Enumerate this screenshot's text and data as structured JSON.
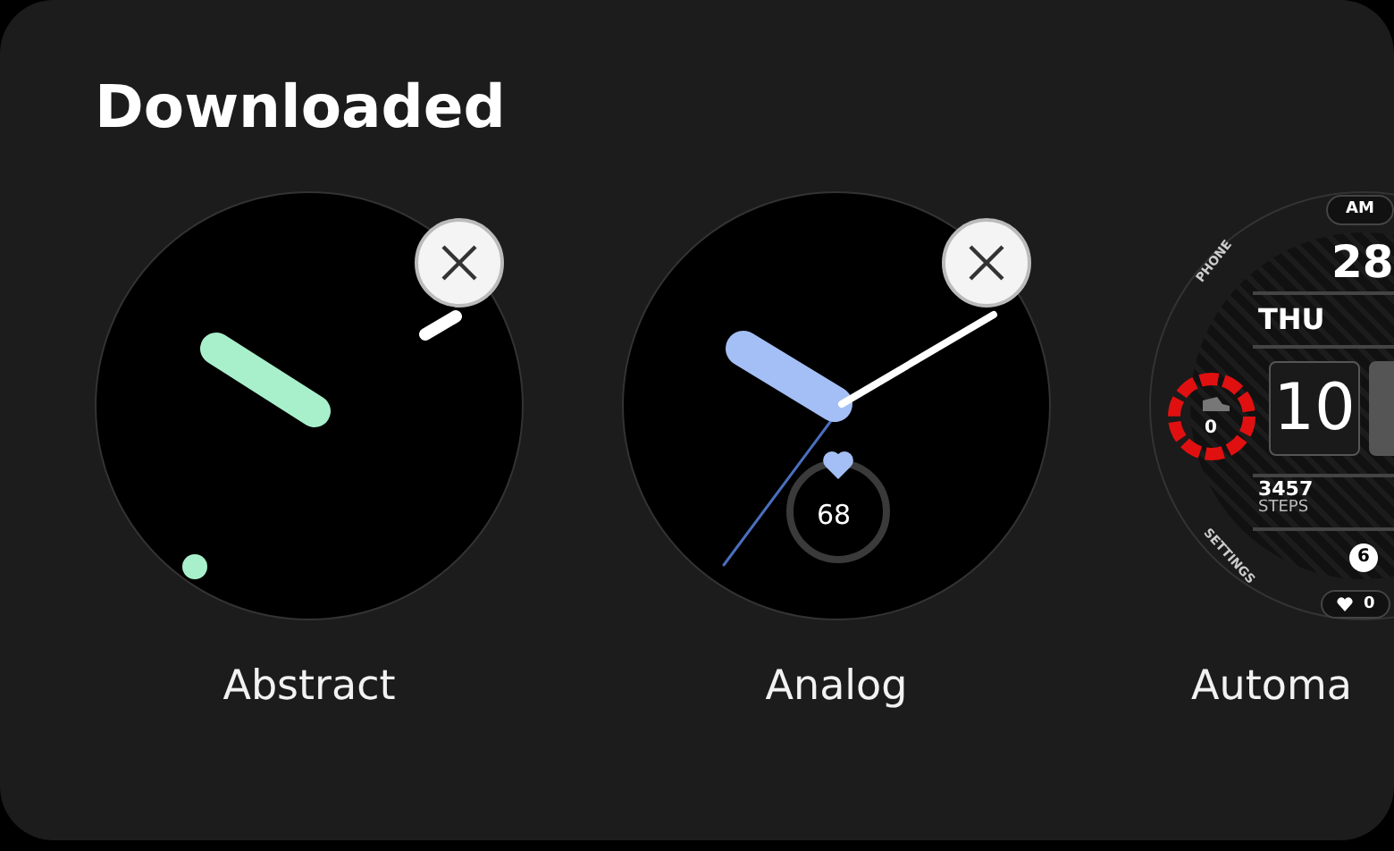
{
  "title": "Downloaded",
  "faces": [
    {
      "name": "Abstract",
      "kind": "abstract",
      "removable": true
    },
    {
      "name": "Analog",
      "kind": "analog",
      "removable": true,
      "heart_rate": "68"
    },
    {
      "name": "Automa",
      "kind": "digital",
      "am_pm": "AM",
      "date": "28",
      "phone_label": "PHONE",
      "day": "THU",
      "activity_count": "0",
      "hour": "10",
      "steps": "3457",
      "steps_label": "STEPS",
      "settings_label": "SETTINGS",
      "notifications": "6",
      "heart_rate": "0"
    }
  ]
}
